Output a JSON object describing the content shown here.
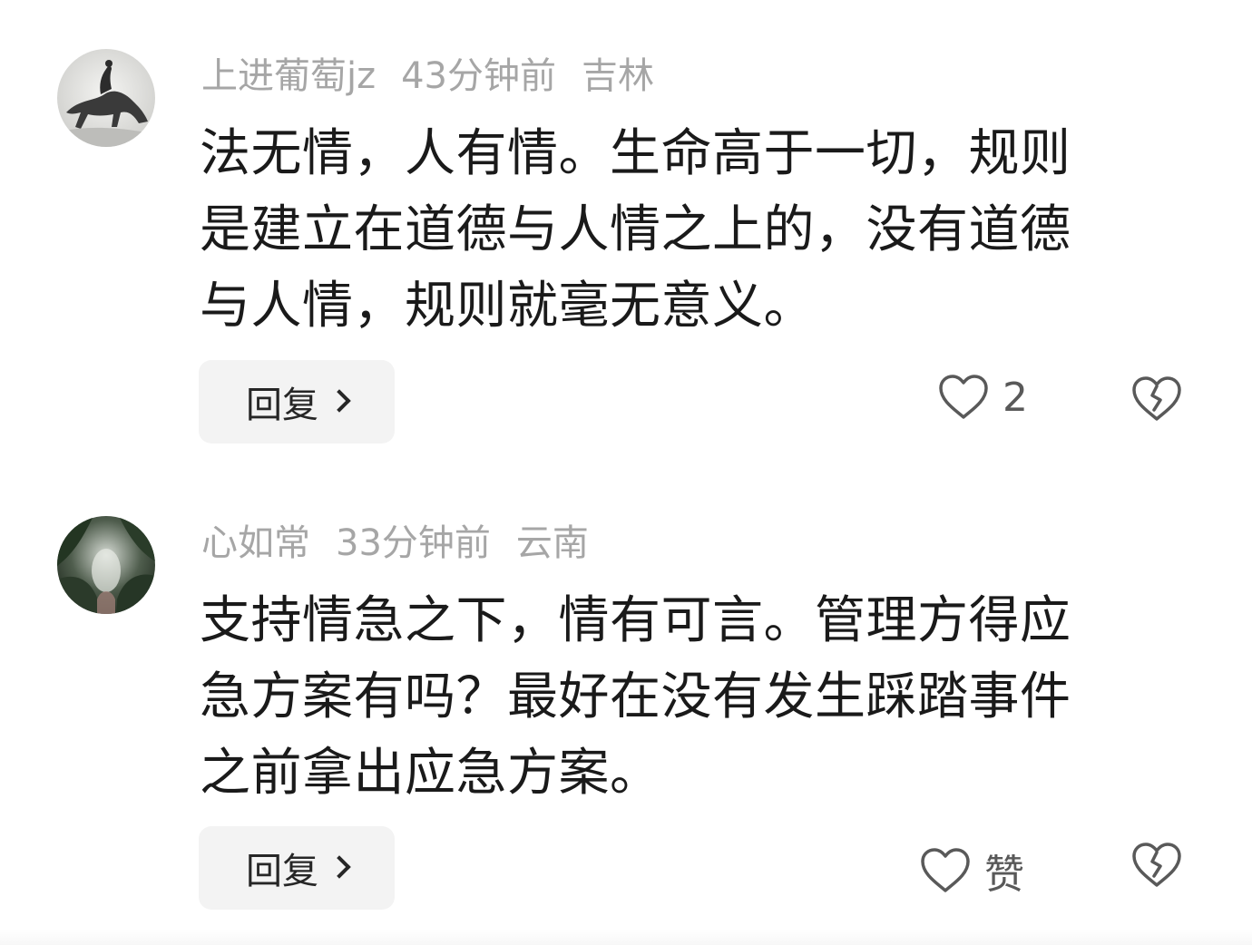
{
  "comments": [
    {
      "username": "上进葡萄jz",
      "time": "43分钟前",
      "location": "吉林",
      "content_lines": [
        "法无情，人有情。生命高于一切，规则",
        "是建立在道德与人情之上的，没有道德",
        "与人情，规则就毫无意义。"
      ],
      "reply_label": "回复",
      "like_text": "2",
      "avatar_icon": "horse-rider-ink-avatar"
    },
    {
      "username": "心如常",
      "time": "33分钟前",
      "location": "云南",
      "content_lines": [
        "支持情急之下，情有可言。管理方得应",
        "急方案有吗？最好在没有发生踩踏事件",
        "之前拿出应急方案。"
      ],
      "reply_label": "回复",
      "like_text": "赞",
      "avatar_icon": "forest-photo-avatar"
    }
  ],
  "icons": {
    "like": "heart-outline-icon",
    "dislike": "broken-heart-icon",
    "chevron": "chevron-right-icon"
  },
  "colors": {
    "meta_text": "#a6a6a6",
    "body_text": "#1a1a1a",
    "reply_bg": "#f3f3f3",
    "icon_stroke": "#595959"
  }
}
